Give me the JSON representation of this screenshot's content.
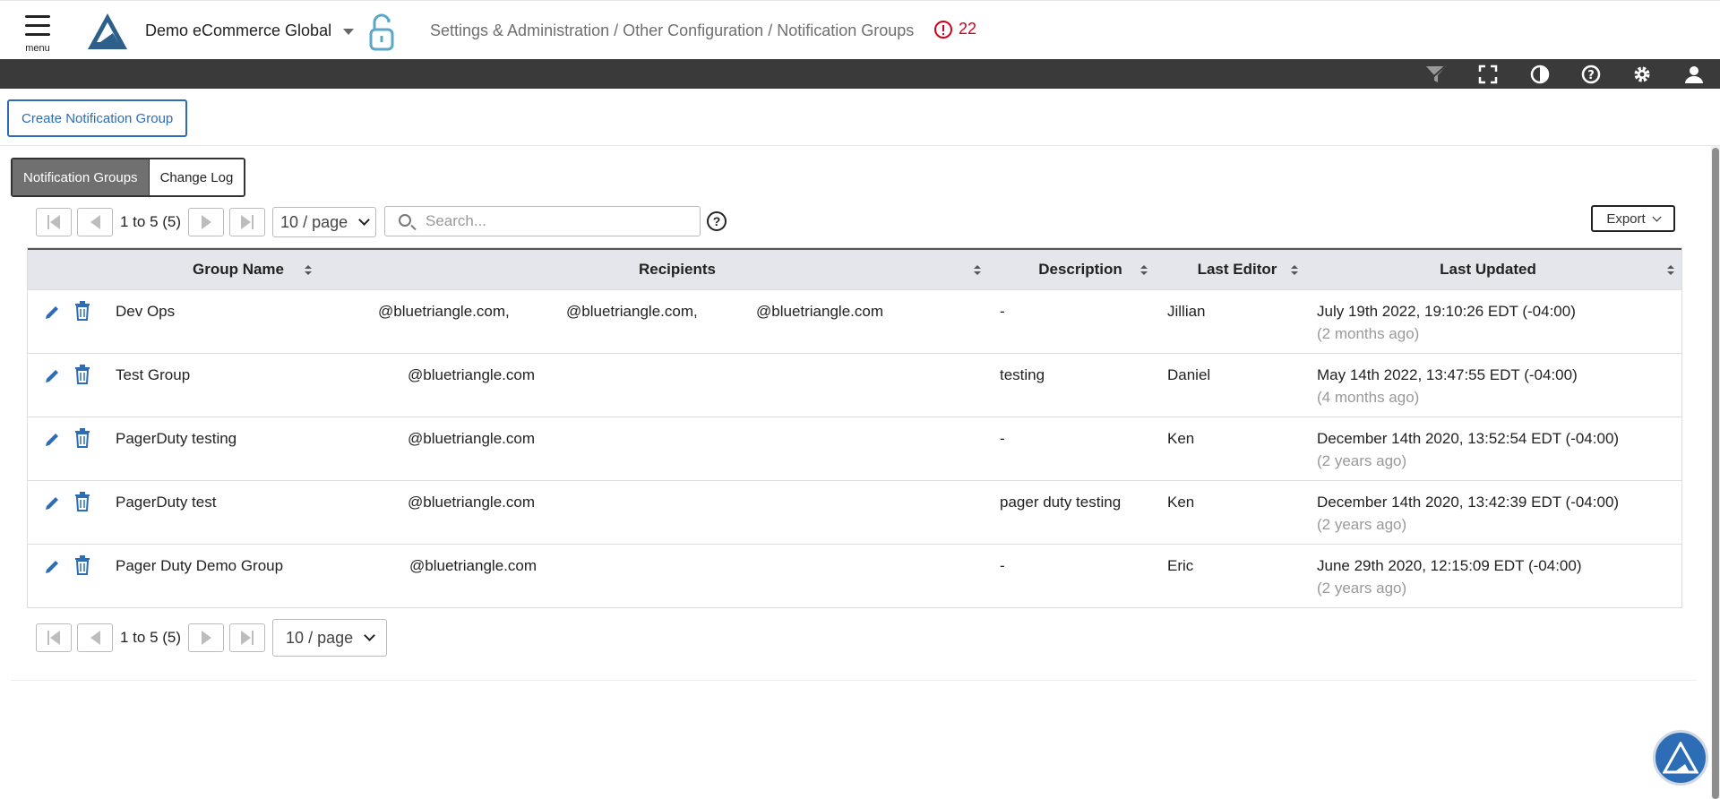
{
  "header": {
    "menu_label": "menu",
    "org_name": "Demo eCommerce Global",
    "breadcrumb": "Settings & Administration / Other Configuration / Notification Groups",
    "alert_count": "22"
  },
  "actions": {
    "create_label": "Create Notification Group"
  },
  "tabs": [
    {
      "label": "Notification Groups",
      "active": true
    },
    {
      "label": "Change Log",
      "active": false
    }
  ],
  "pager": {
    "range": "1 to 5 (5)",
    "page_size": "10 / page"
  },
  "search": {
    "placeholder": "Search..."
  },
  "export_label": "Export",
  "table": {
    "columns": [
      "Group Name",
      "Recipients",
      "Description",
      "Last Editor",
      "Last Updated"
    ],
    "rows": [
      {
        "group": "Dev Ops",
        "recipients": [
          "@bluetriangle.com,",
          "@bluetriangle.com,",
          "@bluetriangle.com"
        ],
        "description": "-",
        "editor": "Jillian",
        "updated": "July 19th 2022, 19:10:26 EDT (-04:00)",
        "ago": "(2 months ago)"
      },
      {
        "group": "Test Group",
        "recipients": [
          "@bluetriangle.com"
        ],
        "description": "testing",
        "editor": "Daniel",
        "updated": "May 14th 2022, 13:47:55 EDT (-04:00)",
        "ago": "(4 months ago)"
      },
      {
        "group": "PagerDuty testing",
        "recipients": [
          "@bluetriangle.com"
        ],
        "description": "-",
        "editor": "Ken",
        "updated": "December 14th 2020, 13:52:54 EDT (-04:00)",
        "ago": "(2 years ago)"
      },
      {
        "group": "PagerDuty test",
        "recipients": [
          "@bluetriangle.com"
        ],
        "description": "pager duty testing",
        "editor": "Ken",
        "updated": "December 14th 2020, 13:42:39 EDT (-04:00)",
        "ago": "(2 years ago)"
      },
      {
        "group": "Pager Duty Demo Group",
        "recipients": [
          "@bluetriangle.com"
        ],
        "description": "-",
        "editor": "Eric",
        "updated": "June 29th 2020, 12:15:09 EDT (-04:00)",
        "ago": "(2 years ago)"
      }
    ]
  },
  "icons": {
    "toolbar": [
      "filter-icon",
      "fullscreen-icon",
      "contrast-icon",
      "help-icon",
      "gear-icon",
      "user-icon"
    ],
    "row_actions": [
      "edit-icon",
      "trash-icon"
    ]
  },
  "colors": {
    "accent": "#2c6db5",
    "alert": "#d0021b",
    "toolbar": "#3a3a3a"
  }
}
